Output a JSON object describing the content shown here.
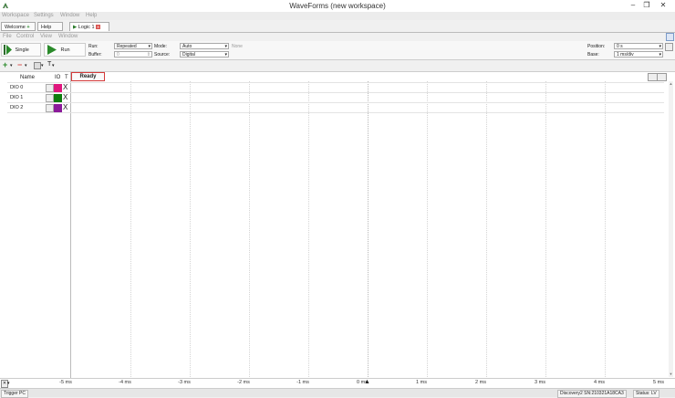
{
  "window": {
    "title": "WaveForms  (new workspace)",
    "controls": [
      "–",
      "❐",
      "✕"
    ]
  },
  "menubar": [
    "Workspace",
    "Settings",
    "Window",
    "Help"
  ],
  "tabs": [
    {
      "label": "Welcome"
    },
    {
      "label": "Help"
    },
    {
      "label": "Logic 1"
    }
  ],
  "submenu": [
    "File",
    "Control",
    "View",
    "Window"
  ],
  "toolbar": {
    "single_label": "Single",
    "run_btn_label": "Run",
    "run_label": "Run:",
    "run_value": "Repeated",
    "buffer_label": "Buffer:",
    "buffer_value": "0",
    "mode_label": "Mode:",
    "mode_value": "Auto",
    "mode_note": "None",
    "source_label": "Source:",
    "source_value": "Digital",
    "position_label": "Position:",
    "position_value": "0 s",
    "base_label": "Base:",
    "base_value": "1 ms/div"
  },
  "columns": {
    "name": "Name",
    "io": "IO",
    "t": "T"
  },
  "status_label": "Ready",
  "signals": [
    {
      "name": "DIO 0",
      "color": "#e0177e",
      "trigger": "X"
    },
    {
      "name": "DIO 1",
      "color": "#0d7d0d",
      "trigger": "X"
    },
    {
      "name": "DIO 2",
      "color": "#8b1a9a",
      "trigger": "X"
    }
  ],
  "axis": {
    "ticks": [
      "-5 ms",
      "-4 ms",
      "-3 ms",
      "-2 ms",
      "-1 ms",
      "0 ms",
      "1 ms",
      "2 ms",
      "3 ms",
      "4 ms",
      "5 ms"
    ]
  },
  "statusbar": {
    "left": "Trigger PC",
    "device": "Discovery2 SN:210321A18CA3",
    "status": "Status: LV"
  }
}
